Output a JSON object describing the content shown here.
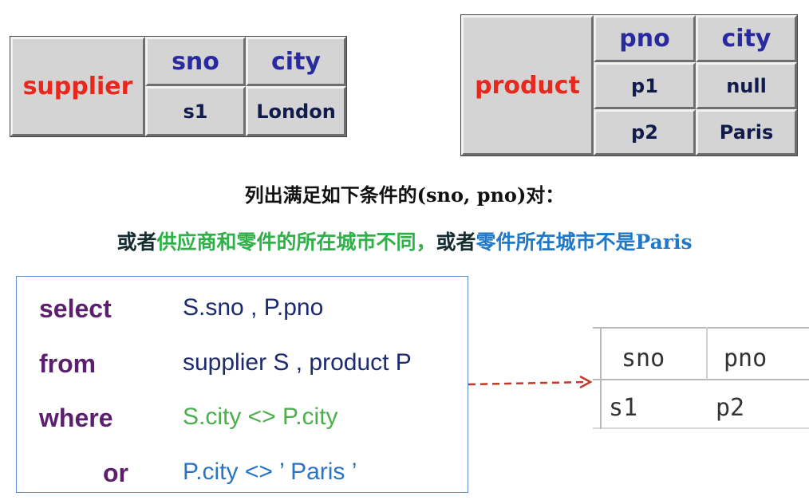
{
  "supplier_table": {
    "name": "supplier",
    "headers": [
      "sno",
      "city"
    ],
    "rows": [
      [
        "s1",
        "London"
      ]
    ]
  },
  "product_table": {
    "name": "product",
    "headers": [
      "pno",
      "city"
    ],
    "rows": [
      [
        "p1",
        "null"
      ],
      [
        "p2",
        "Paris"
      ]
    ]
  },
  "prompt_line1": "列出满足如下条件的(sno, pno)对：",
  "prompt_line2": {
    "part1": "或者",
    "part2": "供应商和零件的所在城市不同，",
    "part3": "或者",
    "part4": "零件所在城市不是Paris"
  },
  "sql": {
    "select_kw": "select",
    "select_arg": "S.sno , P.pno",
    "from_kw": "from",
    "from_arg": "supplier S , product P",
    "where_kw": "where",
    "where_arg": "S.city <> P.city",
    "or_kw": "or",
    "or_arg": "P.city <> ’ Paris ’"
  },
  "result": {
    "headers": [
      "sno",
      "pno"
    ],
    "rows": [
      [
        "s1",
        "p2"
      ]
    ]
  },
  "colors": {
    "table_name": "#e8281c",
    "header": "#2a2aa0",
    "keyword": "#5b1f6e",
    "green": "#4cae4c",
    "blue": "#2a74c4",
    "arrow": "#c0392b"
  }
}
